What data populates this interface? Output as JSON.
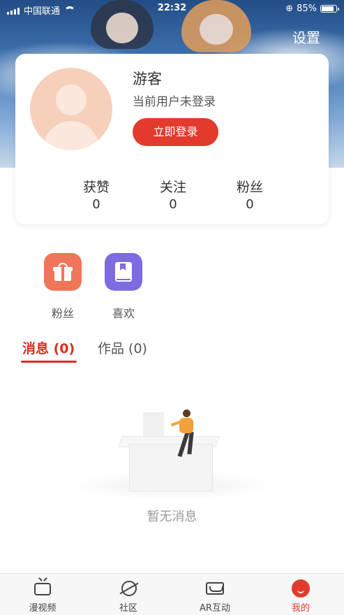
{
  "status_bar": {
    "carrier": "中国联通",
    "time": "22:32",
    "battery": "85%",
    "battery_level": 0.85
  },
  "header": {
    "settings_label": "设置"
  },
  "profile": {
    "name": "游客",
    "login_status": "当前用户未登录",
    "login_button": "立即登录",
    "stats": [
      {
        "label": "获赞",
        "value": "0"
      },
      {
        "label": "关注",
        "value": "0"
      },
      {
        "label": "粉丝",
        "value": "0"
      }
    ]
  },
  "quick_actions": [
    {
      "label": "粉丝",
      "icon": "gift-icon",
      "color": "#ef7659"
    },
    {
      "label": "喜欢",
      "icon": "book-icon",
      "color": "#7d6ce0"
    }
  ],
  "tabs": [
    {
      "label": "消息 (0)",
      "active": true
    },
    {
      "label": "作品 (0)",
      "active": false
    }
  ],
  "empty_state": {
    "text": "暂无消息"
  },
  "bottom_nav": [
    {
      "label": "漫视频",
      "icon": "tv-icon",
      "active": false
    },
    {
      "label": "社区",
      "icon": "planet-icon",
      "active": false
    },
    {
      "label": "AR互动",
      "icon": "vr-headset-icon",
      "active": false
    },
    {
      "label": "我的",
      "icon": "profile-icon",
      "active": true
    }
  ],
  "colors": {
    "accent": "#e23b2e",
    "tab_active": "#d92f20"
  }
}
